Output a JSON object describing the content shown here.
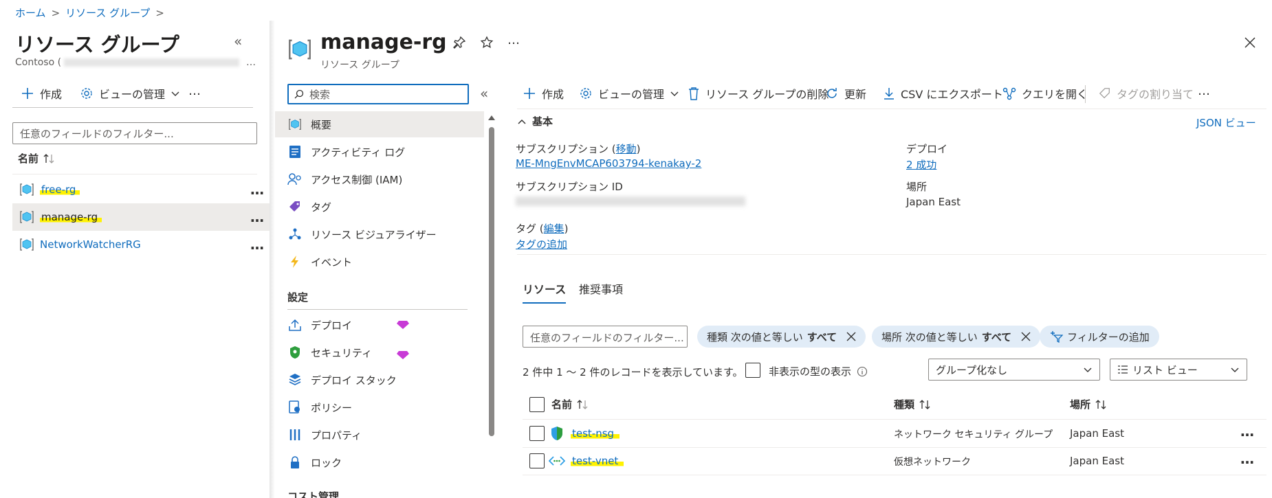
{
  "breadcrumb": {
    "home": "ホーム",
    "sep": ">",
    "current": "リソース グループ"
  },
  "left": {
    "title": "リソース グループ",
    "tenant": "Contoso (",
    "collapse": "«",
    "toolbar": {
      "create": "作成",
      "manage_view": "ビューの管理",
      "more": "…"
    },
    "filter_placeholder": "任意のフィールドのフィルター...",
    "col_name": "名前",
    "rows": [
      {
        "name": "free-rg",
        "more": "…"
      },
      {
        "name": "manage-rg",
        "more": "…"
      },
      {
        "name": "NetworkWatcherRG",
        "more": "…"
      }
    ]
  },
  "blade": {
    "title": "manage-rg",
    "subtitle": "リソース グループ",
    "more": "…",
    "close": "✕"
  },
  "nav": {
    "search_placeholder": "検索",
    "collapse": "«",
    "items": [
      {
        "label": "概要"
      },
      {
        "label": "アクティビティ ログ"
      },
      {
        "label": "アクセス制御 (IAM)"
      },
      {
        "label": "タグ"
      },
      {
        "label": "リソース ビジュアライザー"
      },
      {
        "label": "イベント"
      }
    ],
    "section_settings": "設定",
    "settings_items": [
      {
        "label": "デプロイ"
      },
      {
        "label": "セキュリティ"
      },
      {
        "label": "デプロイ スタック"
      },
      {
        "label": "ポリシー"
      },
      {
        "label": "プロパティ"
      },
      {
        "label": "ロック"
      }
    ],
    "section_cost": "コスト管理"
  },
  "toolbar": {
    "create": "作成",
    "manage_view": "ビューの管理",
    "delete": "リソース グループの削除",
    "refresh": "更新",
    "export_csv": "CSV にエクスポート",
    "open_query": "クエリを開く",
    "assign_tags": "タグの割り当て",
    "more": "…"
  },
  "essentials": {
    "toggle": "基本",
    "json_view": "JSON ビュー",
    "subscription_label": "サブスクリプション (",
    "subscription_move": "移動",
    "subscription_label_end": ")",
    "subscription_value": "ME-MngEnvMCAP603794-kenakay-2",
    "subscription_id_label": "サブスクリプション ID",
    "deploy_label": "デプロイ",
    "deploy_value": "2 成功",
    "location_label": "場所",
    "location_value": "Japan East",
    "tags_label": "タグ (",
    "tags_edit": "編集",
    "tags_label_end": ")",
    "tags_add": "タグの追加"
  },
  "tabs": {
    "resources": "リソース",
    "recommendations": "推奨事項"
  },
  "filters": {
    "placeholder": "任意のフィールドのフィルター...",
    "type_chip_prefix": "種類 次の値と等しい",
    "type_chip_value": "すべて",
    "location_chip_prefix": "場所 次の値と等しい",
    "location_chip_value": "すべて",
    "add_filter": "フィルターの追加"
  },
  "records": {
    "summary": "2 件中 1 ～ 2 件のレコードを表示しています。",
    "show_hidden": "非表示の型の表示",
    "group_by": "グループ化なし",
    "view": "リスト ビュー"
  },
  "table": {
    "col_name": "名前",
    "col_type": "種類",
    "col_location": "場所",
    "rows": [
      {
        "name": "test-nsg",
        "type": "ネットワーク セキュリティ グループ",
        "location": "Japan East",
        "more": "…"
      },
      {
        "name": "test-vnet",
        "type": "仮想ネットワーク",
        "location": "Japan East",
        "more": "…"
      }
    ]
  },
  "colors": {
    "link": "#0f6cbd",
    "highlight": "#fff200",
    "chip": "#e1ecf7"
  }
}
